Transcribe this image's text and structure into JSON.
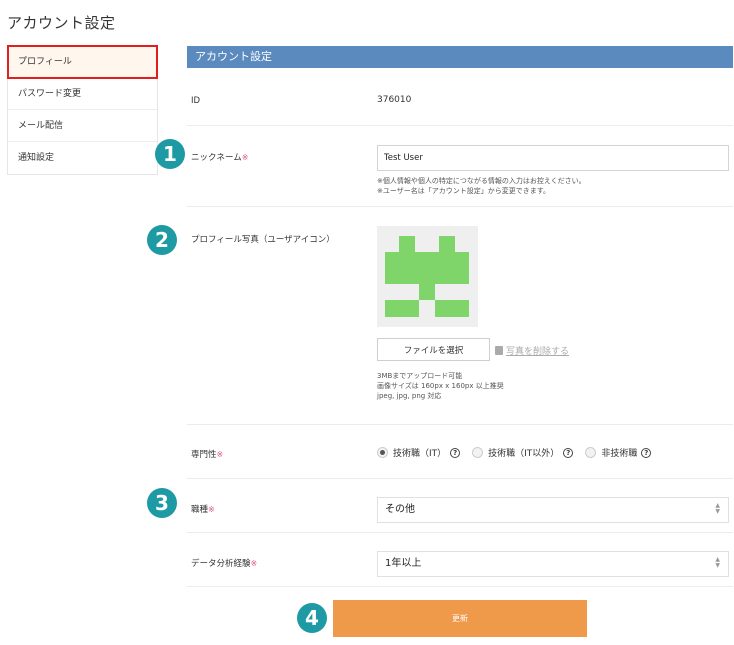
{
  "page_title": "アカウント設定",
  "sidebar": {
    "items": [
      {
        "label": "プロフィール"
      },
      {
        "label": "パスワード変更"
      },
      {
        "label": "メール配信"
      },
      {
        "label": "通知設定"
      }
    ]
  },
  "section_header": "アカウント設定",
  "fields": {
    "id": {
      "label": "ID",
      "value": "376010"
    },
    "nickname": {
      "label": "ニックネーム",
      "required_mark": "※",
      "value": "Test User",
      "note1": "※個人情報や個人の特定につながる情報の入力はお控えください。",
      "note2": "※ユーザー名は「アカウント設定」から変更できます。"
    },
    "photo": {
      "label": "プロフィール写真（ユーザアイコン）",
      "file_button": "ファイルを選択",
      "delete_link": "写真を削除する",
      "note1": "3MBまでアップロード可能",
      "note2": "画像サイズは 160px x 160px 以上推奨",
      "note3": "jpeg, jpg, png 対応"
    },
    "specialty": {
      "label": "専門性",
      "required_mark": "※",
      "options": [
        {
          "label": "技術職（IT）",
          "help": "?"
        },
        {
          "label": "技術職（IT以外）",
          "help": "?"
        },
        {
          "label": "非技術職",
          "help": "?"
        }
      ]
    },
    "job_type": {
      "label": "職種",
      "required_mark": "※",
      "value": "その他"
    },
    "data_exp": {
      "label": "データ分析経験",
      "required_mark": "※",
      "value": "1年以上"
    }
  },
  "submit_label": "更新",
  "badges": [
    "1",
    "2",
    "3",
    "4"
  ],
  "colors": {
    "header": "#5b8abf",
    "submit": "#ee9a4a",
    "badge": "#1e9aa5",
    "active_outline": "#e02020",
    "avatar": "#7fd46a"
  }
}
